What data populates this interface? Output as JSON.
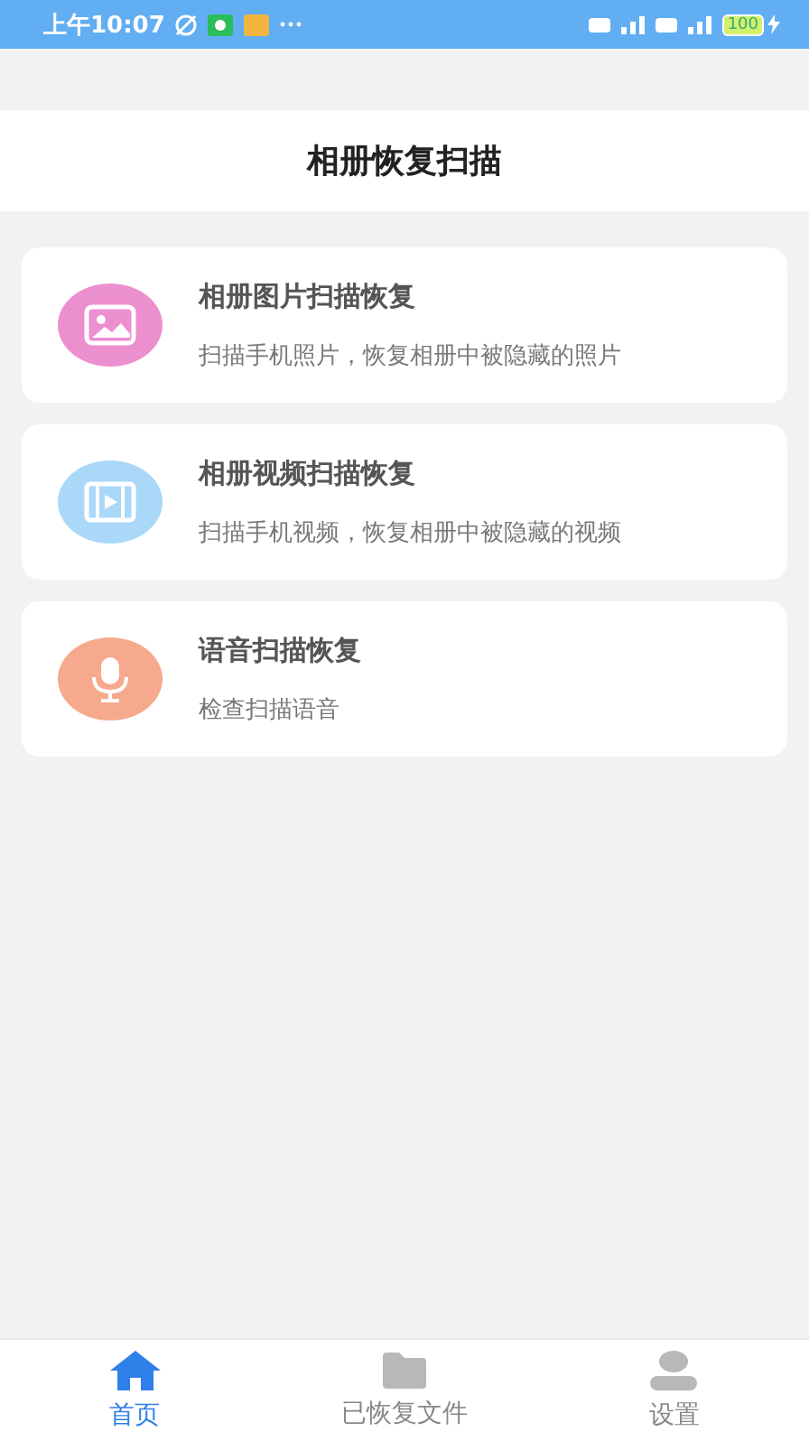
{
  "status_bar": {
    "time": "上午10:07",
    "battery": "100"
  },
  "header": {
    "title": "相册恢复扫描"
  },
  "cards": [
    {
      "kind": "photo",
      "title": "相册图片扫描恢复",
      "subtitle": "扫描手机照片，恢复相册中被隐藏的照片",
      "color": "#ec8fcf"
    },
    {
      "kind": "video",
      "title": "相册视频扫描恢复",
      "subtitle": "扫描手机视频，恢复相册中被隐藏的视频",
      "color": "#a9d8f8"
    },
    {
      "kind": "voice",
      "title": "语音扫描恢复",
      "subtitle": "检查扫描语音",
      "color": "#f6a98c"
    }
  ],
  "tabs": [
    {
      "kind": "home",
      "label": "首页",
      "selected": true
    },
    {
      "kind": "files",
      "label": "已恢复文件",
      "selected": false
    },
    {
      "kind": "settings",
      "label": "设置",
      "selected": false
    }
  ]
}
